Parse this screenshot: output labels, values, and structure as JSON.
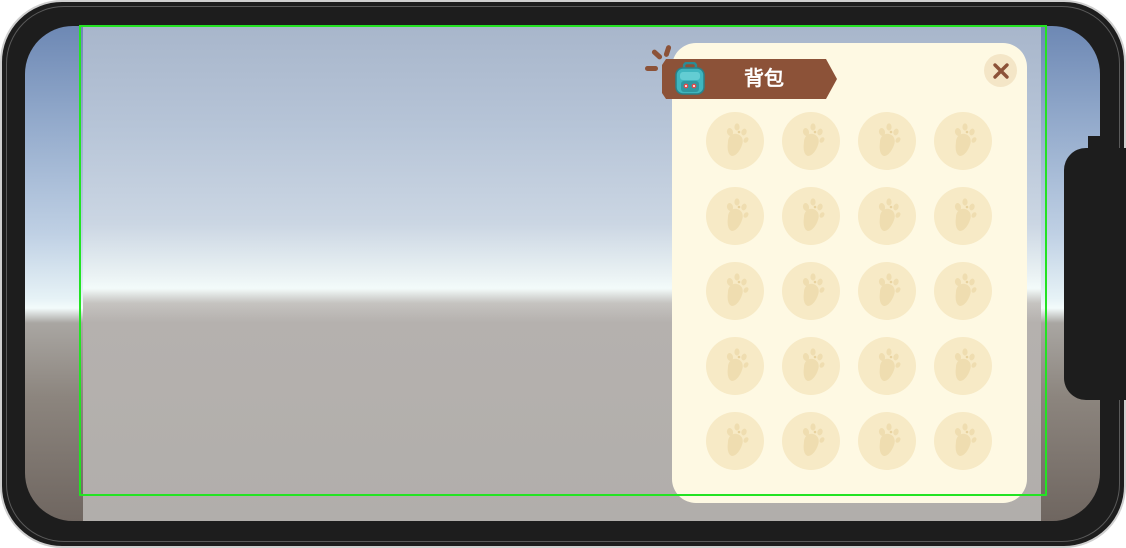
{
  "backpack": {
    "title": "背包",
    "close_icon": "close-icon",
    "bag_icon": "backpack-icon",
    "slot_icon": "paw-placeholder-icon",
    "rows": 5,
    "columns": 4,
    "colors": {
      "panel": "#fef9e3",
      "ribbon": "#8c5238",
      "slot": "#f7eac6",
      "close_bg": "#f4e6c7",
      "close_x": "#8c5238",
      "safe_area": "#23e323"
    }
  }
}
